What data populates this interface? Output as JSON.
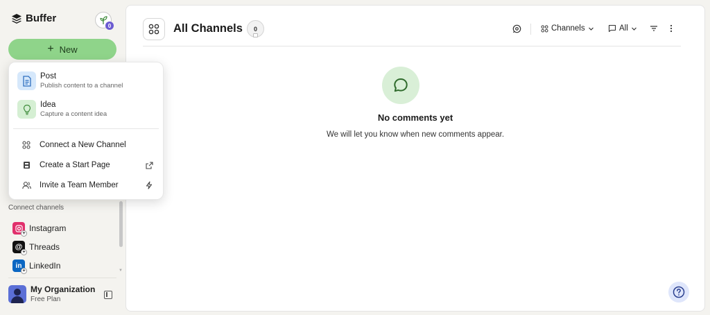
{
  "brand": {
    "name": "Buffer"
  },
  "plan_badge": {
    "count": "0"
  },
  "new_button": {
    "label": "New",
    "color": "#8fd48a"
  },
  "new_menu": {
    "primary_items": [
      {
        "title": "Post",
        "subtitle": "Publish content to a channel",
        "icon": "document-icon",
        "icon_bg": "#d6e8fb"
      },
      {
        "title": "Idea",
        "subtitle": "Capture a content idea",
        "icon": "lightbulb-icon",
        "icon_bg": "#d5efd3"
      }
    ],
    "secondary_items": [
      {
        "label": "Connect a New Channel",
        "icon": "grid-icon"
      },
      {
        "label": "Create a Start Page",
        "icon": "page-icon",
        "trailing_icon": "external-link-icon"
      },
      {
        "label": "Invite a Team Member",
        "icon": "people-icon",
        "trailing_icon": "lightning-icon"
      }
    ]
  },
  "sidebar": {
    "connect_label": "Connect channels",
    "channels": [
      {
        "name": "Instagram",
        "color": "#e1306c"
      },
      {
        "name": "Threads",
        "color": "#111111"
      },
      {
        "name": "LinkedIn",
        "color": "#0a66c2"
      }
    ],
    "organization": {
      "name": "My Organization",
      "plan": "Free Plan"
    }
  },
  "header": {
    "title": "All Channels",
    "count": "0",
    "toolbar": {
      "channels_label": "Channels",
      "filter_label": "All"
    }
  },
  "empty_state": {
    "title": "No comments yet",
    "subtitle": "We will let you know when new comments appear."
  },
  "colors": {
    "accent_green": "#8fd48a",
    "background": "#f4f3ef",
    "help_bg": "#dfe6fb"
  }
}
